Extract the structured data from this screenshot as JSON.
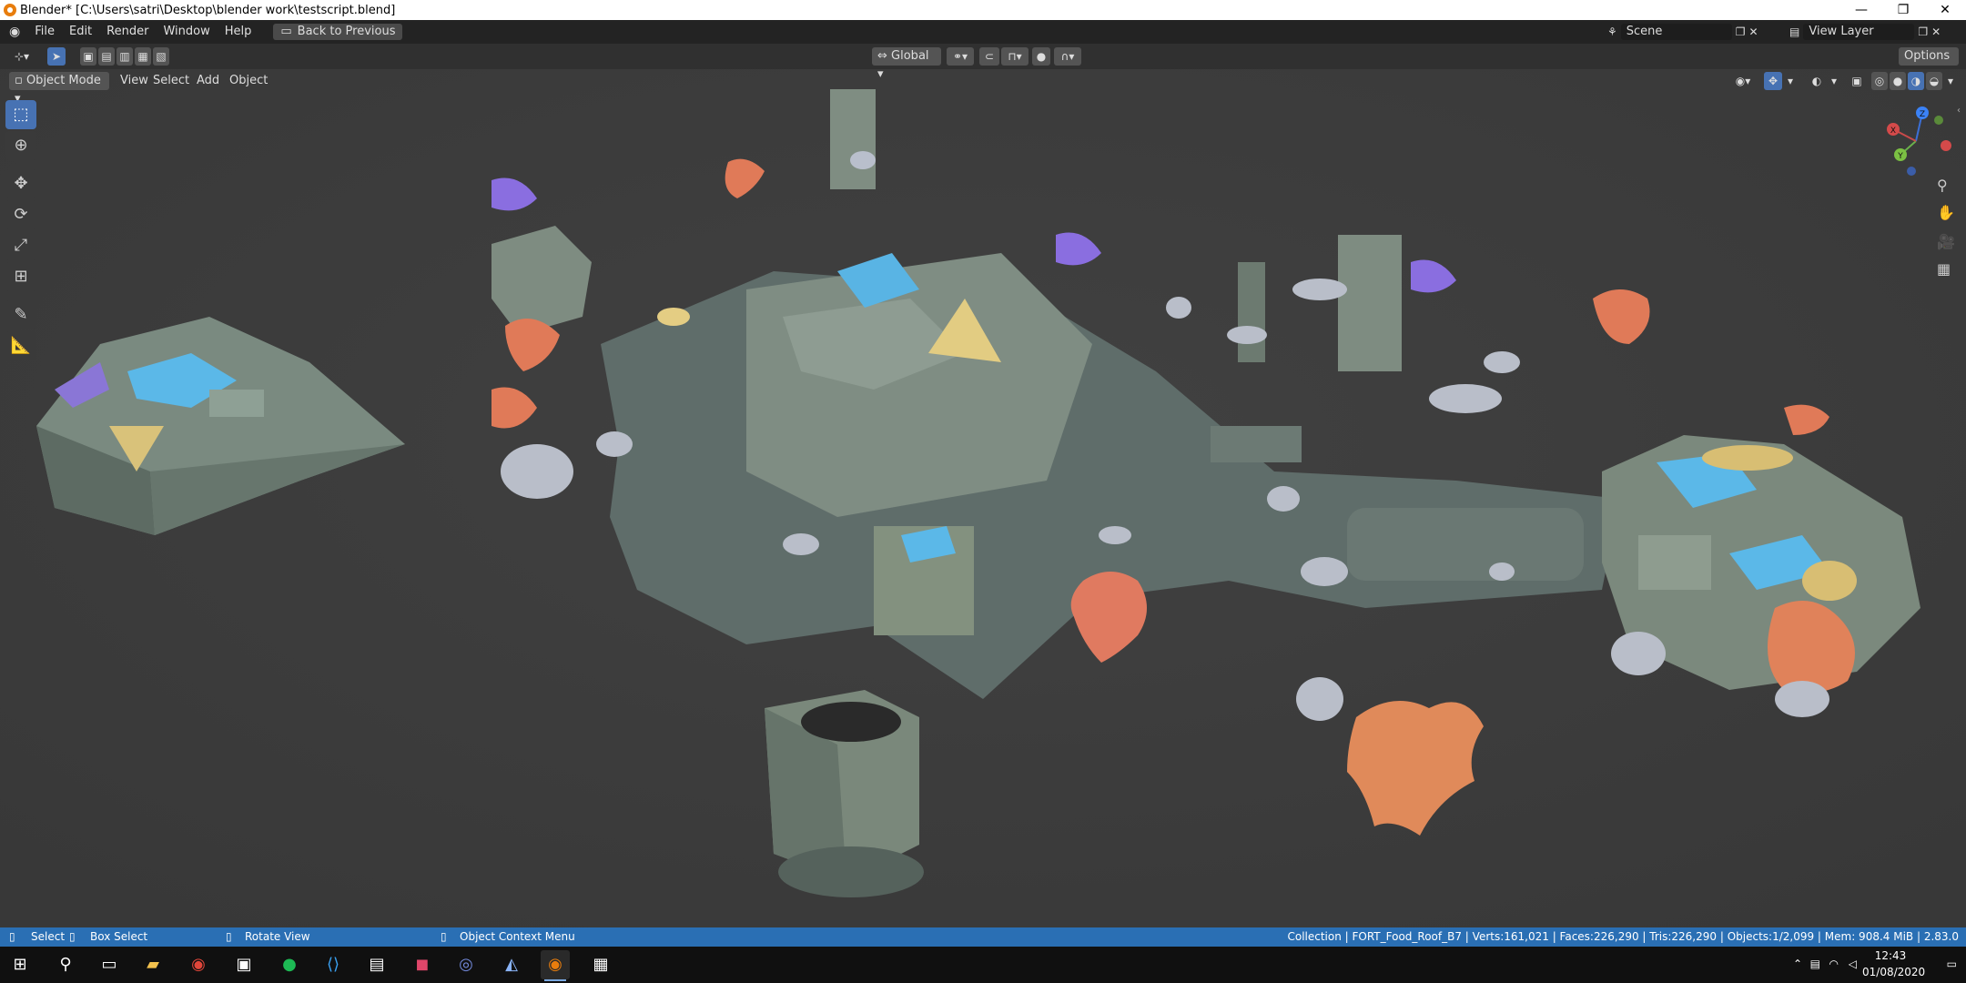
{
  "window": {
    "title": "Blender* [C:\\Users\\satri\\Desktop\\blender work\\testscript.blend]",
    "controls": [
      "—",
      "❐",
      "✕"
    ]
  },
  "menubar": {
    "items": [
      "File",
      "Edit",
      "Render",
      "Window",
      "Help"
    ],
    "back_button": "Back to Previous",
    "scene_label": "Scene",
    "view_layer_label": "View Layer"
  },
  "toolheader": {
    "orientation": "Global",
    "options": "Options"
  },
  "viewheader": {
    "mode": "Object Mode",
    "menus": [
      "View",
      "Select",
      "Add",
      "Object"
    ]
  },
  "lefttools": [
    "select-box",
    "cursor",
    "move",
    "rotate",
    "scale",
    "transform",
    "annotate",
    "measure"
  ],
  "gizmo": {
    "z": "Z",
    "y": "Y",
    "x": "X"
  },
  "statusbar": {
    "select": "Select",
    "box_select": "Box Select",
    "rotate_view": "Rotate View",
    "context_menu": "Object Context Menu",
    "stats": "Collection | FORT_Food_Roof_B7 | Verts:161,021 | Faces:226,290 | Tris:226,290 | Objects:1/2,099 | Mem: 908.4 MiB | 2.83.0"
  },
  "taskbar": {
    "time": "12:43",
    "date": "01/08/2020"
  },
  "colors": {
    "accent": "#4772b3",
    "status": "#2a6fb4",
    "viewport": "#3d3d3d"
  }
}
